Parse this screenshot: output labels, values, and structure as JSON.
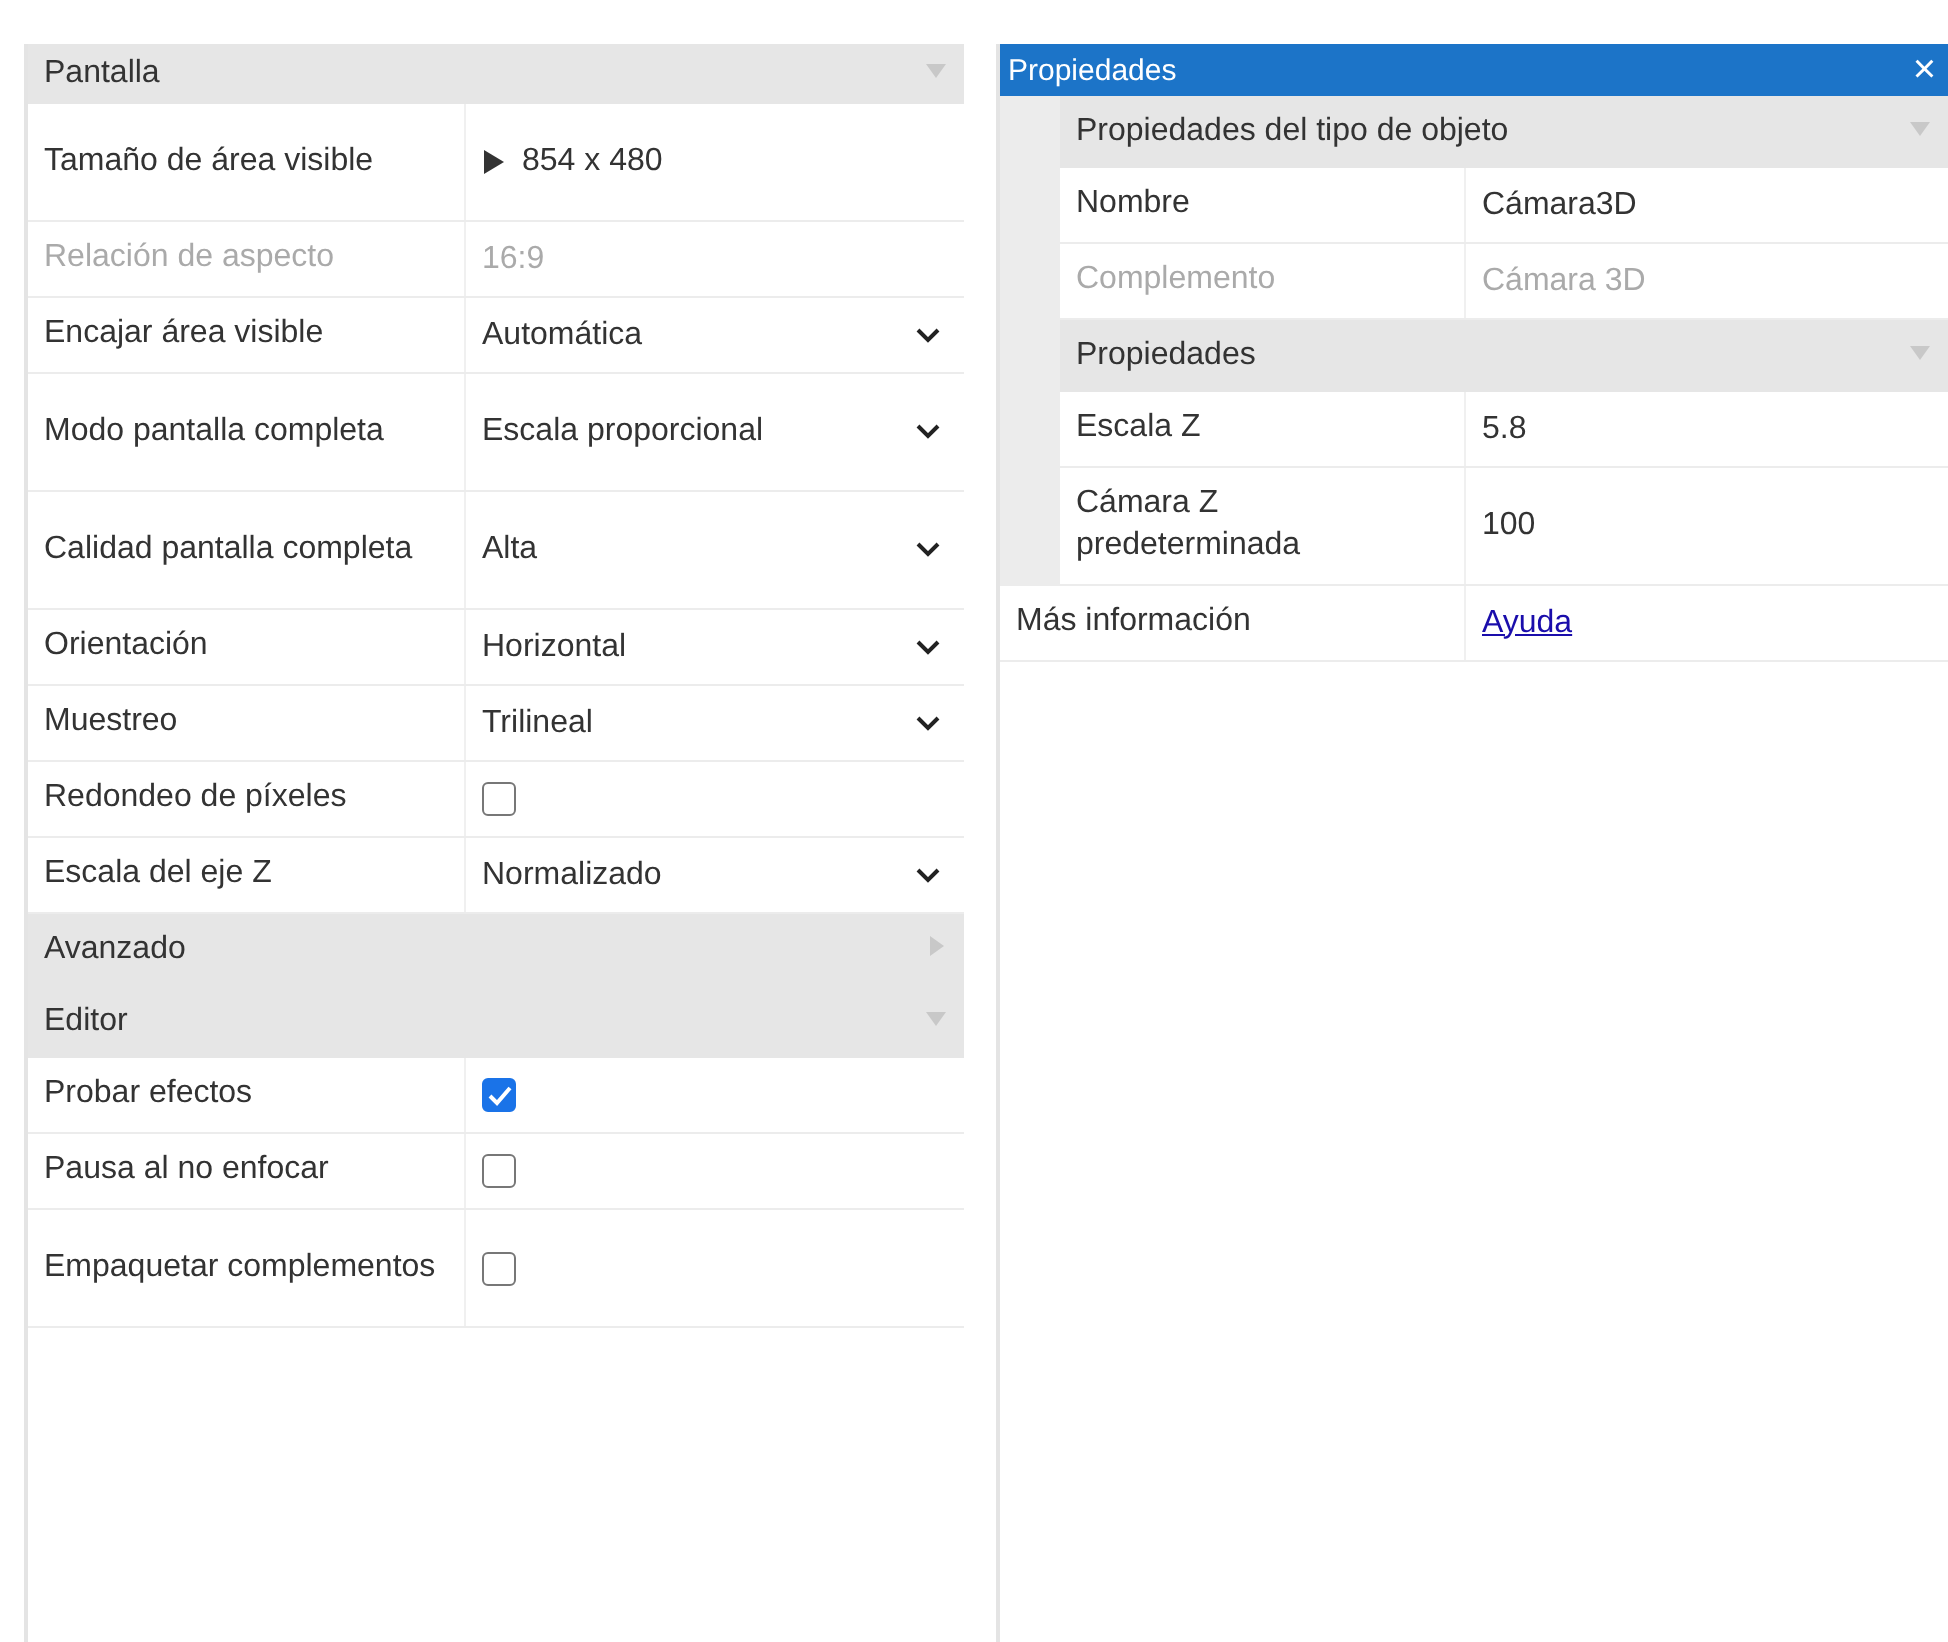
{
  "left_panel": {
    "sections": [
      {
        "title": "Pantalla",
        "expanded": true,
        "rows": [
          {
            "kind": "expandable",
            "label": "Tamaño de área visible",
            "value": "854 x 480",
            "expanded": false,
            "disabled": false
          },
          {
            "kind": "text",
            "label": "Relación de aspecto",
            "value": "16:9",
            "disabled": true
          },
          {
            "kind": "dropdown",
            "label": "Encajar área visible",
            "value": "Automática",
            "disabled": false
          },
          {
            "kind": "dropdown",
            "label": "Modo pantalla completa",
            "value": "Escala proporcional",
            "disabled": false
          },
          {
            "kind": "dropdown",
            "label": "Calidad pantalla completa",
            "value": "Alta",
            "disabled": false
          },
          {
            "kind": "dropdown",
            "label": "Orientación",
            "value": "Horizontal",
            "disabled": false
          },
          {
            "kind": "dropdown",
            "label": "Muestreo",
            "value": "Trilineal",
            "disabled": false
          },
          {
            "kind": "checkbox",
            "label": "Redondeo de píxeles",
            "checked": false,
            "disabled": false
          },
          {
            "kind": "dropdown",
            "label": "Escala del eje Z",
            "value": "Normalizado",
            "disabled": false
          }
        ]
      },
      {
        "title": "Avanzado",
        "expanded": false
      },
      {
        "title": "Editor",
        "expanded": true,
        "rows": [
          {
            "kind": "checkbox",
            "label": "Probar efectos",
            "checked": true,
            "disabled": false
          },
          {
            "kind": "checkbox",
            "label": "Pausa al no enfocar",
            "checked": false,
            "disabled": false
          },
          {
            "kind": "checkbox",
            "label": "Empaquetar complementos",
            "checked": false,
            "disabled": false
          }
        ]
      }
    ]
  },
  "properties_panel": {
    "title": "Propiedades",
    "close": "×",
    "groups": [
      {
        "title": "Propiedades del tipo de objeto",
        "expanded": true,
        "rows": [
          {
            "kind": "text",
            "label": "Nombre",
            "value": "Cámara3D",
            "disabled": false
          },
          {
            "kind": "text",
            "label": "Complemento",
            "value": "Cámara 3D",
            "disabled": true
          }
        ]
      },
      {
        "title": "Propiedades",
        "expanded": true,
        "rows": [
          {
            "kind": "text",
            "label": "Escala Z",
            "value": "5.8",
            "disabled": false
          },
          {
            "kind": "text",
            "label": "Cámara Z predeterminada",
            "value": "100",
            "disabled": false
          }
        ]
      }
    ],
    "footer_row": {
      "kind": "link",
      "label": "Más información",
      "value": "Ayuda"
    }
  }
}
